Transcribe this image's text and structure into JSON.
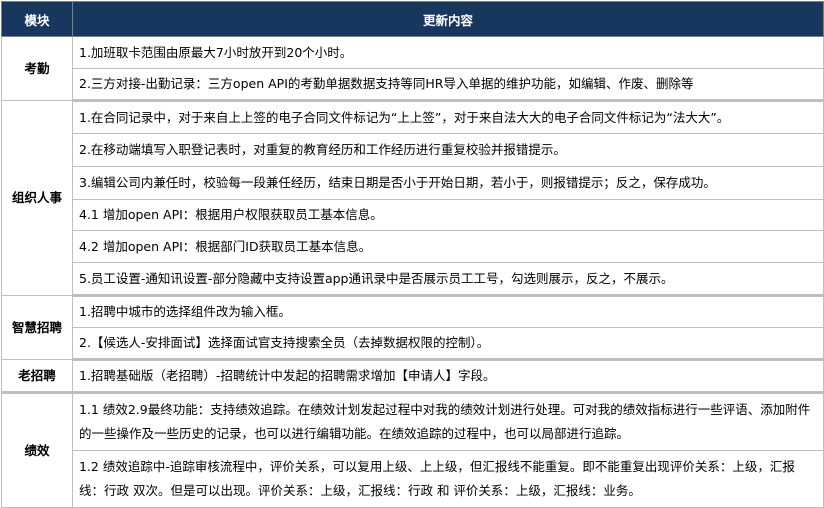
{
  "table": {
    "headers": {
      "module": "模块",
      "content": "更新内容"
    },
    "groups": [
      {
        "module": "考勤",
        "items": [
          "1.加班取卡范围由原最大7小时放开到20个小时。",
          "2.三方对接-出勤记录：三方open API的考勤单据数据支持等同HR导入单据的维护功能，如编辑、作废、删除等"
        ]
      },
      {
        "module": "组织人事",
        "items": [
          "1.在合同记录中，对于来自上上签的电子合同文件标记为“上上签”，对于来自法大大的电子合同文件标记为“法大大”。",
          "2.在移动端填写入职登记表时，对重复的教育经历和工作经历进行重复校验并报错提示。",
          "3.编辑公司内兼任时，校验每一段兼任经历，结束日期是否小于开始日期，若小于，则报错提示；反之，保存成功。",
          "4.1 增加open API：根据用户权限获取员工基本信息。",
          "4.2 增加open API：根据部门ID获取员工基本信息。",
          "5.员工设置-通知讯设置-部分隐藏中支持设置app通讯录中是否展示员工工号，勾选则展示，反之，不展示。"
        ]
      },
      {
        "module": "智慧招聘",
        "items": [
          "1.招聘中城市的选择组件改为输入框。",
          "2.【候选人-安排面试】选择面试官支持搜索全员（去掉数据权限的控制）。"
        ]
      },
      {
        "module": "老招聘",
        "items": [
          "1.招聘基础版（老招聘）-招聘统计中发起的招聘需求增加【申请人】字段。"
        ]
      },
      {
        "module": "绩效",
        "items": [
          "1.1 绩效2.9最终功能：支持绩效追踪。在绩效计划发起过程中对我的绩效计划进行处理。可对我的绩效指标进行一些评语、添加附件的一些操作及一些历史的记录，也可以进行编辑功能。在绩效追踪的过程中，也可以局部进行追踪。",
          "1.2 绩效追踪中-追踪审核流程中，评价关系，可以复用上级、上上级，但汇报线不能重复。即不能重复出现评价关系：上级，汇报线：行政 双次。但是可以出现。评价关系：上级，汇报线：行政 和 评价关系：上级，汇报线：业务。"
        ]
      }
    ]
  }
}
